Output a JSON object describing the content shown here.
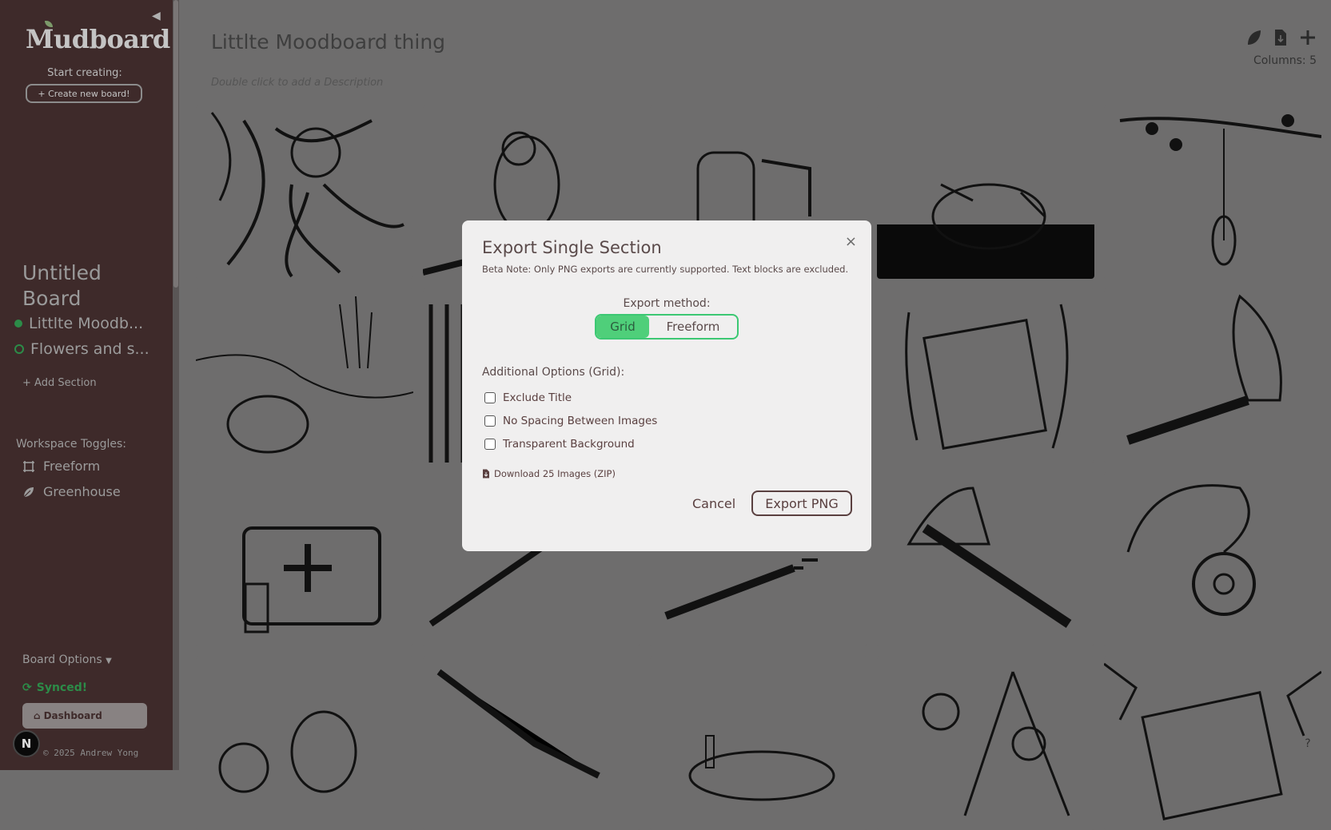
{
  "sidebar": {
    "logo": "Mudboard",
    "start_label": "Start creating:",
    "create_button": "+ Create new board!",
    "board_title": "Untitled Board",
    "sections": [
      {
        "label": "Littlte Moodb..."
      },
      {
        "label": "Flowers and s..."
      }
    ],
    "add_section": "+ Add Section",
    "workspace_label": "Workspace Toggles:",
    "workspace_items": [
      {
        "label": "Freeform",
        "icon": "frame-icon"
      },
      {
        "label": "Greenhouse",
        "icon": "leaf-icon"
      }
    ],
    "board_options": "Board Options",
    "synced": "Synced!",
    "dashboard": "Dashboard",
    "copyright": "© 2025 Andrew Yong",
    "badge": "N"
  },
  "main": {
    "title": "Littlte Moodboard thing",
    "description_placeholder": "Double click to add a Description",
    "columns_label": "Columns: 5",
    "images": [
      "octopus-bear",
      "pig",
      "honey-jar",
      "bear-in-tar",
      "hanging-branch",
      "eeyore-pond",
      "fence",
      "blank",
      "burning-scroll",
      "burning-torch",
      "medical-bag",
      "rifle",
      "shotgun",
      "axe",
      "amulet",
      "honey-jars",
      "knife",
      "candle-table",
      "bears-drawing",
      "cracked-scroll"
    ]
  },
  "modal": {
    "title": "Export Single Section",
    "note": "Beta Note: Only PNG exports are currently supported. Text blocks are excluded.",
    "method_label": "Export method:",
    "method_options": [
      "Grid",
      "Freeform"
    ],
    "selected_method": "Grid",
    "additional_label": "Additional Options (Grid):",
    "options": [
      {
        "label": "Exclude Title",
        "checked": false
      },
      {
        "label": "No Spacing Between Images",
        "checked": false
      },
      {
        "label": "Transparent Background",
        "checked": false
      }
    ],
    "download_link": "Download 25 Images (ZIP)",
    "cancel": "Cancel",
    "export": "Export PNG",
    "close_symbol": "×"
  },
  "colors": {
    "sidebar_bg": "#3e2a2a",
    "accent_green": "#4fcf7a",
    "modal_bg": "#f0efef"
  }
}
